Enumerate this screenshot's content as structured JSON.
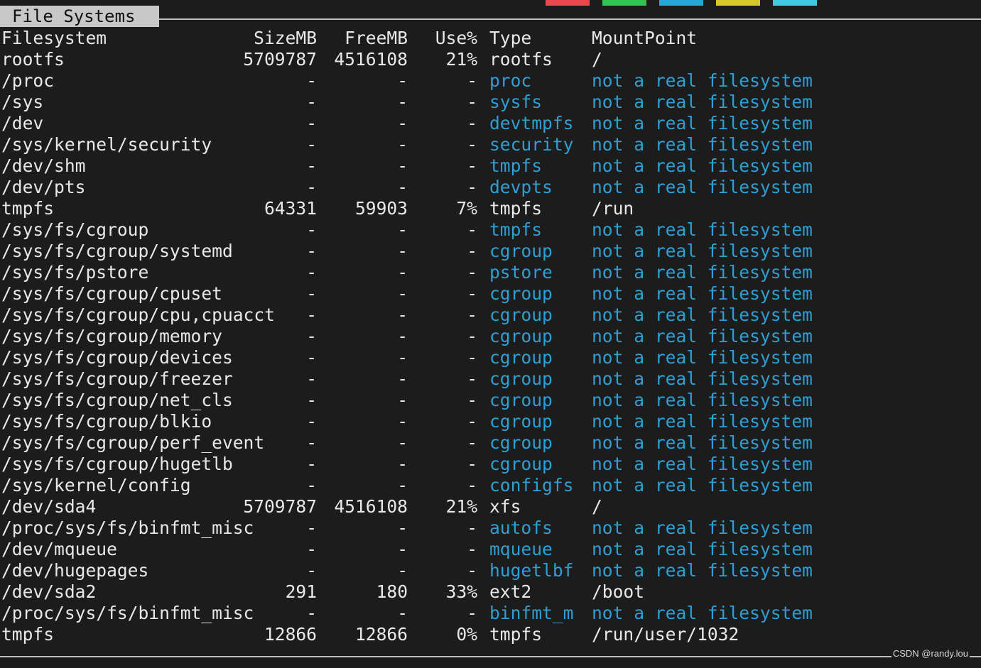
{
  "window": {
    "tab_title": "File Systems",
    "watermark": "CSDN @randy.lou"
  },
  "colors": {
    "background": "#1c1c1c",
    "text": "#e8e8e8",
    "pseudo_fs": "#2e9fd4",
    "tab_bg": "#c8c8c8",
    "chips": [
      "#e8484b",
      "#2fc44f",
      "#2aa6d6",
      "#d6c82a",
      "#3fc8e0"
    ]
  },
  "table": {
    "headers": {
      "filesystem": "Filesystem",
      "size": "SizeMB",
      "free": "FreeMB",
      "use": "Use%",
      "type": "Type",
      "mount": "MountPoint"
    },
    "rows": [
      {
        "filesystem": "rootfs",
        "size": "5709787",
        "free": "4516108",
        "use": "21%",
        "type": "rootfs",
        "mount": "/",
        "pseudo": false
      },
      {
        "filesystem": "/proc",
        "size": "-",
        "free": "-",
        "use": "-",
        "type": "proc",
        "mount": "not a real filesystem",
        "pseudo": true
      },
      {
        "filesystem": "/sys",
        "size": "-",
        "free": "-",
        "use": "-",
        "type": "sysfs",
        "mount": "not a real filesystem",
        "pseudo": true
      },
      {
        "filesystem": "/dev",
        "size": "-",
        "free": "-",
        "use": "-",
        "type": "devtmpfs",
        "mount": "not a real filesystem",
        "pseudo": true
      },
      {
        "filesystem": "/sys/kernel/security",
        "size": "-",
        "free": "-",
        "use": "-",
        "type": "security",
        "mount": "not a real filesystem",
        "pseudo": true
      },
      {
        "filesystem": "/dev/shm",
        "size": "-",
        "free": "-",
        "use": "-",
        "type": "tmpfs",
        "mount": "not a real filesystem",
        "pseudo": true
      },
      {
        "filesystem": "/dev/pts",
        "size": "-",
        "free": "-",
        "use": "-",
        "type": "devpts",
        "mount": "not a real filesystem",
        "pseudo": true
      },
      {
        "filesystem": "tmpfs",
        "size": "64331",
        "free": "59903",
        "use": "7%",
        "type": "tmpfs",
        "mount": "/run",
        "pseudo": false
      },
      {
        "filesystem": "/sys/fs/cgroup",
        "size": "-",
        "free": "-",
        "use": "-",
        "type": "tmpfs",
        "mount": "not a real filesystem",
        "pseudo": true
      },
      {
        "filesystem": "/sys/fs/cgroup/systemd",
        "size": "-",
        "free": "-",
        "use": "-",
        "type": "cgroup",
        "mount": "not a real filesystem",
        "pseudo": true
      },
      {
        "filesystem": "/sys/fs/pstore",
        "size": "-",
        "free": "-",
        "use": "-",
        "type": "pstore",
        "mount": "not a real filesystem",
        "pseudo": true
      },
      {
        "filesystem": "/sys/fs/cgroup/cpuset",
        "size": "-",
        "free": "-",
        "use": "-",
        "type": "cgroup",
        "mount": "not a real filesystem",
        "pseudo": true
      },
      {
        "filesystem": "/sys/fs/cgroup/cpu,cpuacct",
        "size": "-",
        "free": "-",
        "use": "-",
        "type": "cgroup",
        "mount": "not a real filesystem",
        "pseudo": true
      },
      {
        "filesystem": "/sys/fs/cgroup/memory",
        "size": "-",
        "free": "-",
        "use": "-",
        "type": "cgroup",
        "mount": "not a real filesystem",
        "pseudo": true
      },
      {
        "filesystem": "/sys/fs/cgroup/devices",
        "size": "-",
        "free": "-",
        "use": "-",
        "type": "cgroup",
        "mount": "not a real filesystem",
        "pseudo": true
      },
      {
        "filesystem": "/sys/fs/cgroup/freezer",
        "size": "-",
        "free": "-",
        "use": "-",
        "type": "cgroup",
        "mount": "not a real filesystem",
        "pseudo": true
      },
      {
        "filesystem": "/sys/fs/cgroup/net_cls",
        "size": "-",
        "free": "-",
        "use": "-",
        "type": "cgroup",
        "mount": "not a real filesystem",
        "pseudo": true
      },
      {
        "filesystem": "/sys/fs/cgroup/blkio",
        "size": "-",
        "free": "-",
        "use": "-",
        "type": "cgroup",
        "mount": "not a real filesystem",
        "pseudo": true
      },
      {
        "filesystem": "/sys/fs/cgroup/perf_event",
        "size": "-",
        "free": "-",
        "use": "-",
        "type": "cgroup",
        "mount": "not a real filesystem",
        "pseudo": true
      },
      {
        "filesystem": "/sys/fs/cgroup/hugetlb",
        "size": "-",
        "free": "-",
        "use": "-",
        "type": "cgroup",
        "mount": "not a real filesystem",
        "pseudo": true
      },
      {
        "filesystem": "/sys/kernel/config",
        "size": "-",
        "free": "-",
        "use": "-",
        "type": "configfs",
        "mount": "not a real filesystem",
        "pseudo": true
      },
      {
        "filesystem": "/dev/sda4",
        "size": "5709787",
        "free": "4516108",
        "use": "21%",
        "type": "xfs",
        "mount": "/",
        "pseudo": false
      },
      {
        "filesystem": "/proc/sys/fs/binfmt_misc",
        "size": "-",
        "free": "-",
        "use": "-",
        "type": "autofs",
        "mount": "not a real filesystem",
        "pseudo": true
      },
      {
        "filesystem": "/dev/mqueue",
        "size": "-",
        "free": "-",
        "use": "-",
        "type": "mqueue",
        "mount": "not a real filesystem",
        "pseudo": true
      },
      {
        "filesystem": "/dev/hugepages",
        "size": "-",
        "free": "-",
        "use": "-",
        "type": "hugetlbf",
        "mount": "not a real filesystem",
        "pseudo": true
      },
      {
        "filesystem": "/dev/sda2",
        "size": "291",
        "free": "180",
        "use": "33%",
        "type": "ext2",
        "mount": "/boot",
        "pseudo": false
      },
      {
        "filesystem": "/proc/sys/fs/binfmt_misc",
        "size": "-",
        "free": "-",
        "use": "-",
        "type": "binfmt_m",
        "mount": "not a real filesystem",
        "pseudo": true
      },
      {
        "filesystem": "tmpfs",
        "size": "12866",
        "free": "12866",
        "use": "0%",
        "type": "tmpfs",
        "mount": "/run/user/1032",
        "pseudo": false
      }
    ]
  }
}
